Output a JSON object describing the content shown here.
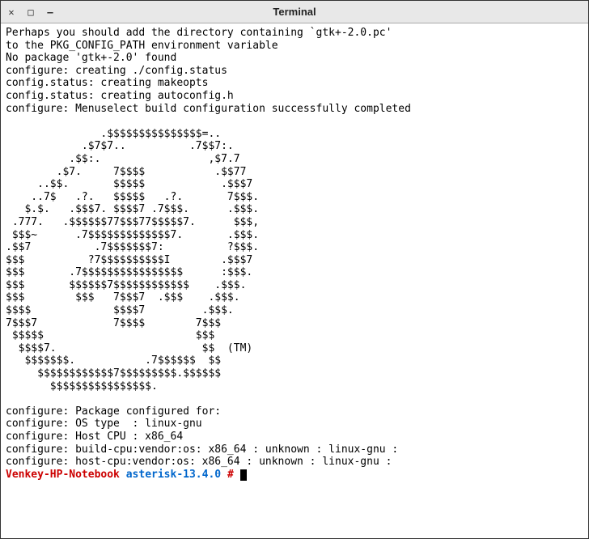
{
  "window": {
    "title": "Terminal"
  },
  "terminal": {
    "lines": [
      "Perhaps you should add the directory containing `gtk+-2.0.pc'",
      "to the PKG_CONFIG_PATH environment variable",
      "No package 'gtk+-2.0' found",
      "configure: creating ./config.status",
      "config.status: creating makeopts",
      "config.status: creating autoconfig.h",
      "configure: Menuselect build configuration successfully completed",
      "",
      "               .$$$$$$$$$$$$$$$=..",
      "            .$7$7..          .7$$7:.",
      "          .$$:.                 ,$7.7",
      "        .$7.     7$$$$           .$$77",
      "     ..$$.       $$$$$            .$$$7",
      "    ..7$   .?.   $$$$$   .?.       7$$$.",
      "   $.$.   .$$$7. $$$$7 .7$$$.      .$$$.",
      " .777.   .$$$$$$77$$$77$$$$$7.      $$$,",
      " $$$~      .7$$$$$$$$$$$$$7.       .$$$.",
      ".$$7          .7$$$$$$$7:          ?$$$.",
      "$$$          ?7$$$$$$$$$$I        .$$$7",
      "$$$       .7$$$$$$$$$$$$$$$$      :$$$.",
      "$$$       $$$$$$7$$$$$$$$$$$$    .$$$.",
      "$$$        $$$   7$$$7  .$$$    .$$$.",
      "$$$$             $$$$7         .$$$.",
      "7$$$7            7$$$$        7$$$",
      " $$$$$                        $$$",
      "  $$$$7.                       $$  (TM)",
      "   $$$$$$$.           .7$$$$$$  $$",
      "     $$$$$$$$$$$$7$$$$$$$$$.$$$$$$",
      "       $$$$$$$$$$$$$$$$.",
      "",
      "configure: Package configured for:",
      "configure: OS type  : linux-gnu",
      "configure: Host CPU : x86_64",
      "configure: build-cpu:vendor:os: x86_64 : unknown : linux-gnu :",
      "configure: host-cpu:vendor:os: x86_64 : unknown : linux-gnu :"
    ],
    "prompt": {
      "host": "Venkey-HP-Notebook",
      "dir": "asterisk-13.4.0",
      "symbol": "#"
    }
  }
}
